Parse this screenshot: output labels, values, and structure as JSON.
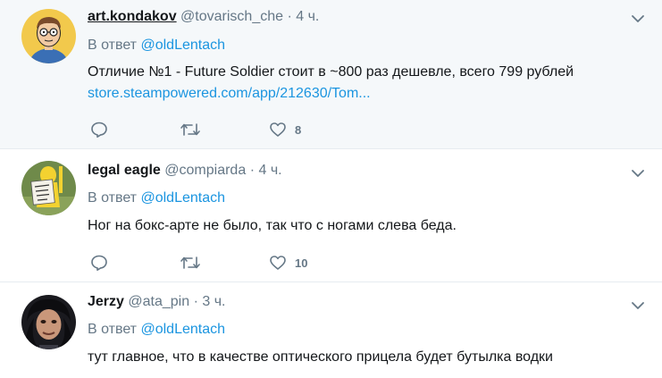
{
  "tweets": [
    {
      "name": "art.kondakov",
      "handle": "@tovarisch_che",
      "dot": "·",
      "time": "4 ч.",
      "reply_prefix": "В ответ",
      "reply_to": "@oldLentach",
      "text": "Отличие №1 - Future Soldier стоит в ~800 раз дешевле, всего 799 рублей",
      "link": "store.steampowered.com/app/212630/Tom...",
      "likes": "8",
      "avatar_icon": "cartoon-avatar"
    },
    {
      "name": "legal eagle",
      "handle": "@compiarda",
      "dot": "·",
      "time": "4 ч.",
      "reply_prefix": "В ответ",
      "reply_to": "@oldLentach",
      "text": "Ног на бокс-арте не было, так что с ногами слева беда.",
      "likes": "10",
      "avatar_icon": "homer-sign-avatar"
    },
    {
      "name": "Jerzy",
      "handle": "@ata_pin",
      "dot": "·",
      "time": "3 ч.",
      "reply_prefix": "В ответ",
      "reply_to": "@oldLentach",
      "text": "тут главное, что в качестве оптического прицела будет бутылка водки",
      "avatar_icon": "photo-avatar"
    }
  ],
  "icons": {
    "reply": "reply-icon",
    "retweet": "retweet-icon",
    "like": "heart-icon",
    "more": "chevron-down-icon"
  },
  "colors": {
    "link": "#1b95e0",
    "secondary": "#657786",
    "highlight_bg": "#f5f8fa",
    "divider": "#e6ecf0"
  }
}
